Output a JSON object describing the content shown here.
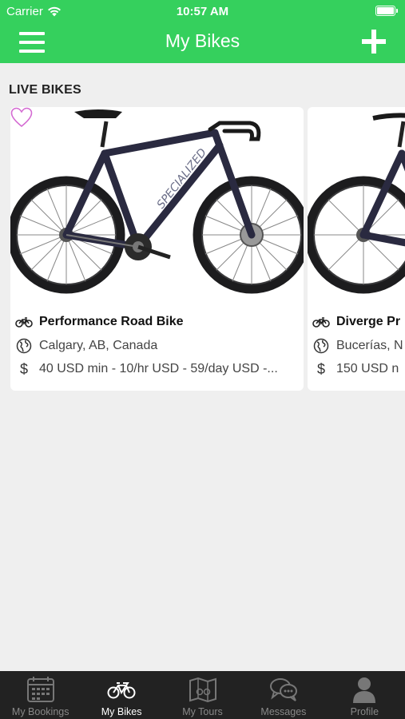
{
  "status_bar": {
    "carrier": "Carrier",
    "time": "10:57 AM"
  },
  "nav": {
    "title": "My Bikes"
  },
  "section": {
    "title": "LIVE BIKES"
  },
  "bikes": [
    {
      "title": "Performance Road Bike",
      "location": "Calgary, AB, Canada",
      "price": "40 USD min - 10/hr USD - 59/day USD -...",
      "favorited": false
    },
    {
      "title": "Diverge Pr",
      "location": "Bucerías, N",
      "price": "150 USD n"
    }
  ],
  "tabs": [
    {
      "label": "My Bookings",
      "icon": "calendar-icon",
      "active": false
    },
    {
      "label": "My Bikes",
      "icon": "bicycle-icon",
      "active": true
    },
    {
      "label": "My Tours",
      "icon": "map-icon",
      "active": false
    },
    {
      "label": "Messages",
      "icon": "chat-bubbles-icon",
      "active": false
    },
    {
      "label": "Profile",
      "icon": "person-icon",
      "active": false
    }
  ],
  "colors": {
    "brand_green": "#35d05d",
    "tabbar_bg": "#222222",
    "heart": "#d46bd2"
  },
  "icons": {
    "currency": "$"
  }
}
